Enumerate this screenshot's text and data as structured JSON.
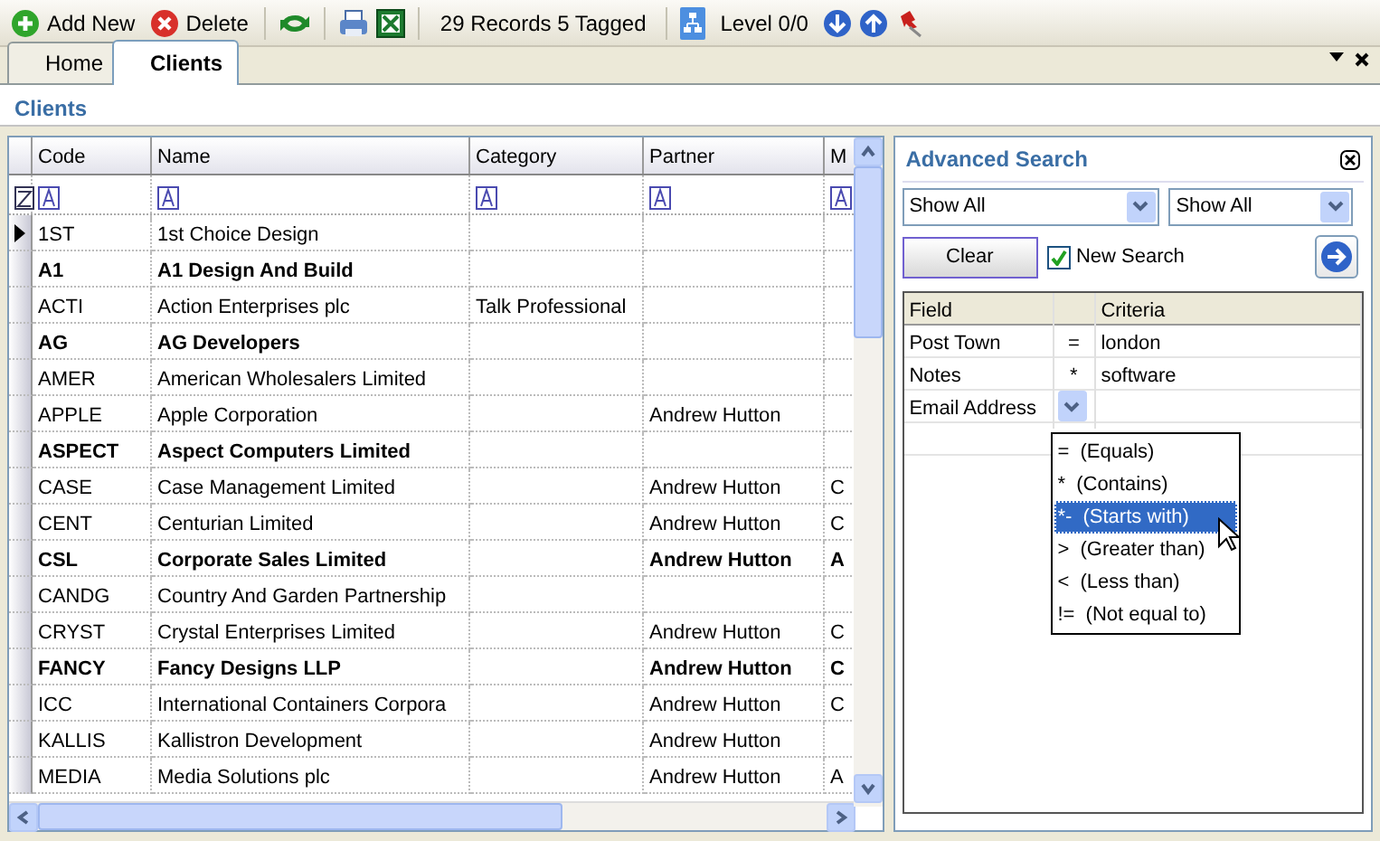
{
  "toolbar": {
    "add_label": "Add New",
    "delete_label": "Delete",
    "record_count": "29 Records 5 Tagged",
    "level": "Level 0/0"
  },
  "tabs": [
    {
      "label": "Home",
      "selected": false
    },
    {
      "label": "Clients",
      "selected": true
    }
  ],
  "page_title": "Clients",
  "grid": {
    "columns": [
      "Code",
      "Name",
      "Category",
      "Partner",
      "M"
    ],
    "rows": [
      {
        "cells": [
          "1ST",
          "1st Choice Design",
          "",
          "",
          ""
        ],
        "tagged": false,
        "selected": true
      },
      {
        "cells": [
          "A1",
          "A1 Design And Build",
          "",
          "",
          ""
        ],
        "tagged": true,
        "selected": false
      },
      {
        "cells": [
          "ACTI",
          "Action Enterprises plc",
          "Talk Professional",
          "",
          ""
        ],
        "tagged": false,
        "selected": false
      },
      {
        "cells": [
          "AG",
          "AG Developers",
          "",
          "",
          ""
        ],
        "tagged": true,
        "selected": false
      },
      {
        "cells": [
          "AMER",
          "American Wholesalers Limited",
          "",
          "",
          ""
        ],
        "tagged": false,
        "selected": false
      },
      {
        "cells": [
          "APPLE",
          "Apple Corporation",
          "",
          "Andrew Hutton",
          ""
        ],
        "tagged": false,
        "selected": false
      },
      {
        "cells": [
          "ASPECT",
          "Aspect Computers Limited",
          "",
          "",
          ""
        ],
        "tagged": true,
        "selected": false
      },
      {
        "cells": [
          "CASE",
          "Case Management Limited",
          "",
          "Andrew Hutton",
          "C"
        ],
        "tagged": false,
        "selected": false
      },
      {
        "cells": [
          "CENT",
          "Centurian Limited",
          "",
          "Andrew Hutton",
          "C"
        ],
        "tagged": false,
        "selected": false
      },
      {
        "cells": [
          "CSL",
          "Corporate Sales Limited",
          "",
          "Andrew Hutton",
          "A"
        ],
        "tagged": true,
        "selected": false
      },
      {
        "cells": [
          "CANDG",
          "Country And Garden Partnership",
          "",
          "",
          ""
        ],
        "tagged": false,
        "selected": false
      },
      {
        "cells": [
          "CRYST",
          "Crystal Enterprises Limited",
          "",
          "Andrew Hutton",
          "C"
        ],
        "tagged": false,
        "selected": false
      },
      {
        "cells": [
          "FANCY",
          "Fancy Designs LLP",
          "",
          "Andrew Hutton",
          "C"
        ],
        "tagged": true,
        "selected": false
      },
      {
        "cells": [
          "ICC",
          "International Containers Corpora",
          "",
          "Andrew Hutton",
          "C"
        ],
        "tagged": false,
        "selected": false
      },
      {
        "cells": [
          "KALLIS",
          "Kallistron Development",
          "",
          "Andrew Hutton",
          ""
        ],
        "tagged": false,
        "selected": false
      },
      {
        "cells": [
          "MEDIA",
          "Media Solutions plc",
          "",
          "Andrew Hutton",
          "A"
        ],
        "tagged": false,
        "selected": false
      }
    ]
  },
  "advanced_search": {
    "title": "Advanced Search",
    "filter_1": "Show All",
    "filter_2": "Show All",
    "clear_label": "Clear",
    "new_search": {
      "label": "New Search",
      "checked": true
    },
    "criteria_columns": [
      "Field",
      "",
      "Criteria"
    ],
    "criteria": [
      {
        "field": "Post Town",
        "op": "=",
        "value": "london"
      },
      {
        "field": "Notes",
        "op": "*",
        "value": "software"
      },
      {
        "field": "Email Address",
        "editing": true
      }
    ],
    "operator_options": [
      {
        "text": "=  (Equals)",
        "selected": false
      },
      {
        "text": "*  (Contains)",
        "selected": false
      },
      {
        "text": "*-  (Starts with)",
        "selected": true
      },
      {
        "text": ">  (Greater than)",
        "selected": false
      },
      {
        "text": "<  (Less than)",
        "selected": false
      },
      {
        "text": "!=  (Not equal to)",
        "selected": false
      }
    ]
  }
}
